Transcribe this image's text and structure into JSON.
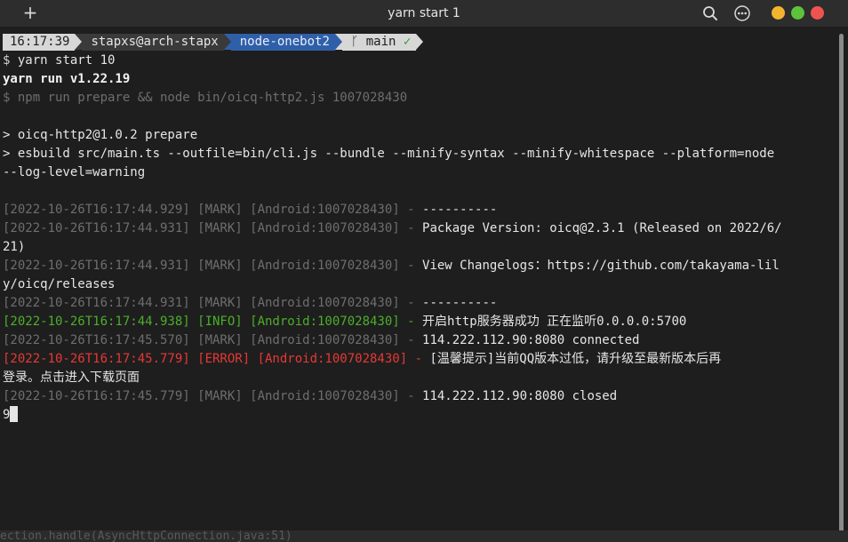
{
  "window": {
    "title": "yarn start 1",
    "new_tab_glyph": "+",
    "icons": [
      "plus-icon",
      "search-icon",
      "more-icon"
    ],
    "controls": {
      "minimize_color": "#f4b52e",
      "maximize_color": "#5cc33a",
      "close_color": "#ef5350"
    }
  },
  "prompt": {
    "time": "16:17:39",
    "user_host": "stapxs@arch-stapx",
    "directory": "node-onebot2",
    "branch_glyph": "ᚴ",
    "branch": "main",
    "status": "✓"
  },
  "lines": {
    "cmd_sign": "$",
    "cmd": " yarn start 10",
    "yarn_version": "yarn run v1.22.19",
    "npm_cmd": "$ npm run prepare && node bin/oicq-http2.js 1007028430",
    "prepare": "> oicq-http2@1.0.2 prepare",
    "esbuild_1": "> esbuild src/main.ts --outfile=bin/cli.js --bundle --minify-syntax --minify-whitespace --platform=node",
    "esbuild_2": "--log-level=warning",
    "log1_prefix": "[2022-10-26T16:17:44.929] [MARK] [Android:1007028430] -",
    "log1_msg": " ----------",
    "log2_prefix": "[2022-10-26T16:17:44.931] [MARK] [Android:1007028430] -",
    "log2_msg": " Package Version: oicq@2.3.1 (Released on 2022/6/",
    "log2_cont": "21)",
    "log3_prefix": "[2022-10-26T16:17:44.931] [MARK] [Android:1007028430] -",
    "log3_msg": " View Changelogs：https://github.com/takayama-lil",
    "log3_cont": "y/oicq/releases",
    "log4_prefix": "[2022-10-26T16:17:44.931] [MARK] [Android:1007028430] -",
    "log4_msg": " ----------",
    "log5_prefix": "[2022-10-26T16:17:44.938] [INFO] [Android:1007028430] -",
    "log5_msg": " 开启http服务器成功 正在监听0.0.0.0:5700",
    "log6_prefix": "[2022-10-26T16:17:45.570] [MARK] [Android:1007028430] -",
    "log6_msg": " 114.222.112.90:8080 connected",
    "log7_prefix": "[2022-10-26T16:17:45.779] [ERROR] [Android:1007028430] -",
    "log7_msg": " [温馨提示]当前QQ版本过低，请升级至最新版本后再",
    "log7_cont": "登录。点击进入下载页面",
    "log8_prefix": "[2022-10-26T16:17:45.779] [MARK] [Android:1007028430] -",
    "log8_msg": " 114.222.112.90:8080 closed",
    "input": "9"
  },
  "background_text": "ection.handle(AsyncHttpConnection.java:51)"
}
